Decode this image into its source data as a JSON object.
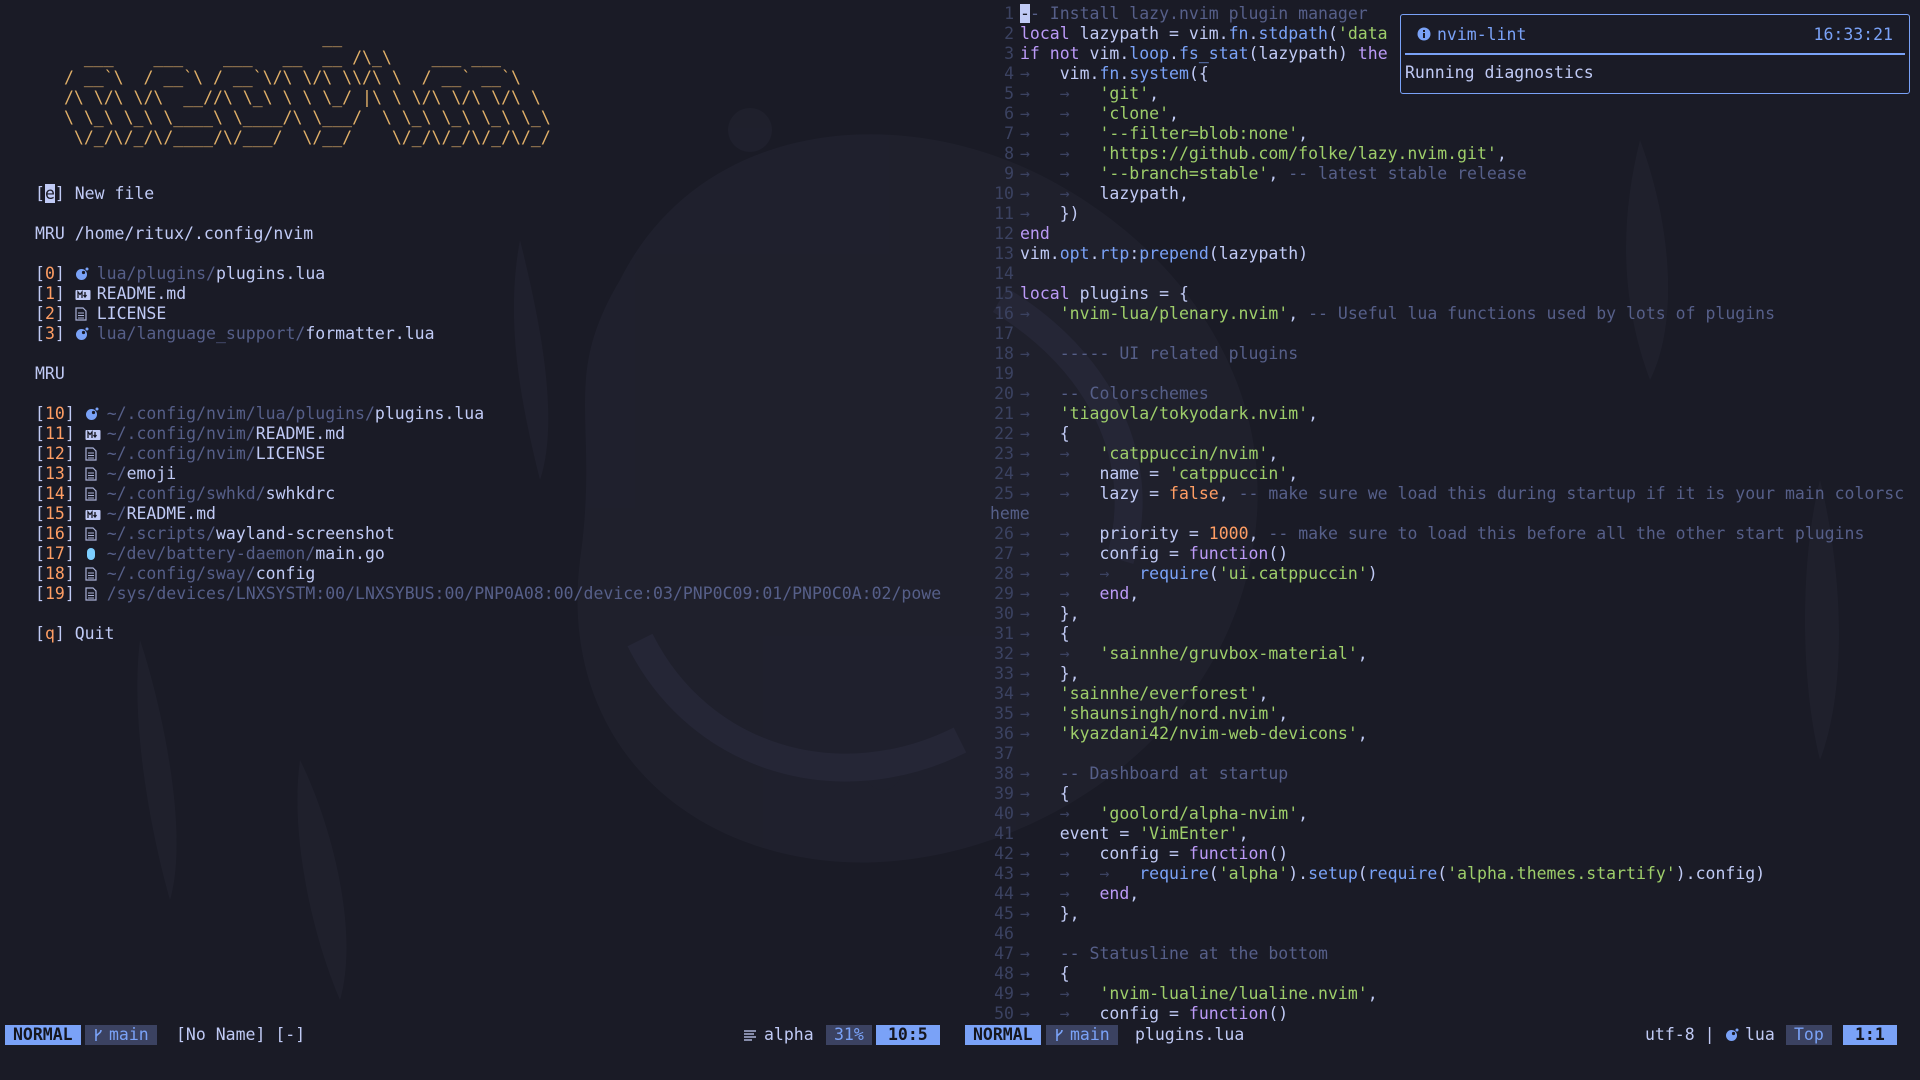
{
  "colors": {
    "background": "#1a1b26",
    "accent": "#7aa2f7",
    "banner": "#e0af68",
    "string": "#9ece6a",
    "keyword": "#bb9af7",
    "comment": "#565f89",
    "number": "#ff9e64"
  },
  "left": {
    "banner": "                          __\n  ___    ___    ___   __  __ /\\_\\    ___ ___\n/ __`\\  / __`\\ / __`\\/\\ \\/\\ \\\\/\\ \\  / __` __`\\\n/\\ \\/\\ \\/\\  __//\\ \\_\\ \\ \\ \\_/ |\\ \\ \\/\\ \\/\\ \\/\\ \\\n\\ \\_\\ \\_\\ \\____\\ \\____/\\ \\___/  \\ \\_\\ \\_\\ \\_\\ \\_\\\n \\/_/\\/_/\\/____/\\/___/  \\/__/    \\/_/\\/_/\\/_/\\/_/",
    "new_file": {
      "key": "e",
      "label": "New file"
    },
    "mru_cwd_header": "MRU /home/ritux/.config/nvim",
    "mru_cwd": [
      {
        "idx": "0",
        "icon": "lua-icon",
        "dir": "lua/plugins/",
        "file": "plugins.lua"
      },
      {
        "idx": "1",
        "icon": "markdown-icon",
        "dir": "",
        "file": "README.md"
      },
      {
        "idx": "2",
        "icon": "file-icon",
        "dir": "",
        "file": "LICENSE"
      },
      {
        "idx": "3",
        "icon": "lua-icon",
        "dir": "lua/language_support/",
        "file": "formatter.lua"
      }
    ],
    "mru_header": "MRU",
    "mru": [
      {
        "idx": "10",
        "icon": "lua-icon",
        "dir": "~/.config/nvim/lua/plugins/",
        "file": "plugins.lua"
      },
      {
        "idx": "11",
        "icon": "markdown-icon",
        "dir": "~/.config/nvim/",
        "file": "README.md"
      },
      {
        "idx": "12",
        "icon": "file-icon",
        "dir": "~/.config/nvim/",
        "file": "LICENSE"
      },
      {
        "idx": "13",
        "icon": "file-icon",
        "dir": "~/",
        "file": "emoji"
      },
      {
        "idx": "14",
        "icon": "file-icon",
        "dir": "~/.config/swhkd/",
        "file": "swhkdrc"
      },
      {
        "idx": "15",
        "icon": "markdown-icon",
        "dir": "~/",
        "file": "README.md"
      },
      {
        "idx": "16",
        "icon": "file-icon",
        "dir": "~/.scripts/",
        "file": "wayland-screenshot"
      },
      {
        "idx": "17",
        "icon": "go-icon",
        "dir": "~/dev/battery-daemon/",
        "file": "main.go"
      },
      {
        "idx": "18",
        "icon": "file-icon",
        "dir": "~/.config/sway/",
        "file": "config"
      },
      {
        "idx": "19",
        "icon": "file-icon",
        "dir": "/sys/devices/LNXSYSTM:00/LNXSYBUS:00/PNP0A08:00/device:03/PNP0C09:01/PNP0C0A:02/powe",
        "file": ""
      }
    ],
    "quit": {
      "key": "q",
      "label": "Quit"
    }
  },
  "code_lines": [
    {
      "n": "1",
      "i": 0,
      "t": [
        [
          "cur",
          "-"
        ],
        [
          "c",
          "- Install lazy.nvim plugin manager"
        ]
      ]
    },
    {
      "n": "2",
      "i": 0,
      "t": [
        [
          "k",
          "local "
        ],
        [
          "v",
          "lazypath = vim."
        ],
        [
          "f",
          "fn"
        ],
        [
          "v",
          "."
        ],
        [
          "f",
          "stdpath"
        ],
        [
          "p",
          "("
        ],
        [
          "s",
          "'data"
        ]
      ]
    },
    {
      "n": "3",
      "i": 0,
      "t": [
        [
          "k",
          "if not "
        ],
        [
          "v",
          "vim."
        ],
        [
          "f",
          "loop"
        ],
        [
          "v",
          "."
        ],
        [
          "f",
          "fs_stat"
        ],
        [
          "p",
          "("
        ],
        [
          "v",
          "lazypath"
        ],
        [
          "p",
          ") "
        ],
        [
          "k",
          "the"
        ]
      ]
    },
    {
      "n": "4",
      "i": 1,
      "t": [
        [
          "v",
          "vim."
        ],
        [
          "f",
          "fn"
        ],
        [
          "v",
          "."
        ],
        [
          "f",
          "system"
        ],
        [
          "p",
          "({"
        ]
      ]
    },
    {
      "n": "5",
      "i": 2,
      "t": [
        [
          "s",
          "'git'"
        ],
        [
          "p",
          ","
        ]
      ]
    },
    {
      "n": "6",
      "i": 2,
      "t": [
        [
          "s",
          "'clone'"
        ],
        [
          "p",
          ","
        ]
      ]
    },
    {
      "n": "7",
      "i": 2,
      "t": [
        [
          "s",
          "'--filter=blob:none'"
        ],
        [
          "p",
          ","
        ]
      ]
    },
    {
      "n": "8",
      "i": 2,
      "t": [
        [
          "s",
          "'https://github.com/folke/lazy.nvim.git'"
        ],
        [
          "p",
          ","
        ]
      ]
    },
    {
      "n": "9",
      "i": 2,
      "t": [
        [
          "s",
          "'--branch=stable'"
        ],
        [
          "p",
          ", "
        ],
        [
          "c",
          "-- latest stable release"
        ]
      ]
    },
    {
      "n": "10",
      "i": 2,
      "t": [
        [
          "v",
          "lazypath"
        ],
        [
          "p",
          ","
        ]
      ]
    },
    {
      "n": "11",
      "i": 1,
      "t": [
        [
          "p",
          "})"
        ]
      ]
    },
    {
      "n": "12",
      "i": 0,
      "t": [
        [
          "k",
          "end"
        ]
      ]
    },
    {
      "n": "13",
      "i": 0,
      "t": [
        [
          "v",
          "vim."
        ],
        [
          "f",
          "opt"
        ],
        [
          "v",
          "."
        ],
        [
          "f",
          "rtp"
        ],
        [
          "p",
          ":"
        ],
        [
          "f",
          "prepend"
        ],
        [
          "p",
          "("
        ],
        [
          "v",
          "lazypath"
        ],
        [
          "p",
          ")"
        ]
      ]
    },
    {
      "n": "14",
      "i": 0,
      "t": []
    },
    {
      "n": "15",
      "i": 0,
      "t": [
        [
          "k",
          "local "
        ],
        [
          "v",
          "plugins = "
        ],
        [
          "p",
          "{"
        ]
      ]
    },
    {
      "n": "16",
      "i": 1,
      "t": [
        [
          "s",
          "'nvim-lua/plenary.nvim'"
        ],
        [
          "p",
          ", "
        ],
        [
          "c",
          "-- Useful lua functions used by lots of plugins"
        ]
      ]
    },
    {
      "n": "17",
      "i": 0,
      "t": []
    },
    {
      "n": "18",
      "i": 1,
      "t": [
        [
          "c",
          "----- UI related plugins"
        ]
      ]
    },
    {
      "n": "19",
      "i": 0,
      "t": []
    },
    {
      "n": "20",
      "i": 1,
      "t": [
        [
          "c",
          "-- Colorschemes"
        ]
      ]
    },
    {
      "n": "21",
      "i": 1,
      "t": [
        [
          "s",
          "'tiagovla/tokyodark.nvim'"
        ],
        [
          "p",
          ","
        ]
      ]
    },
    {
      "n": "22",
      "i": 1,
      "t": [
        [
          "p",
          "{"
        ]
      ]
    },
    {
      "n": "23",
      "i": 2,
      "t": [
        [
          "s",
          "'catppuccin/nvim'"
        ],
        [
          "p",
          ","
        ]
      ]
    },
    {
      "n": "24",
      "i": 2,
      "t": [
        [
          "v",
          "name = "
        ],
        [
          "s",
          "'catppuccin'"
        ],
        [
          "p",
          ","
        ]
      ]
    },
    {
      "n": "25",
      "i": 2,
      "t": [
        [
          "v",
          "lazy = "
        ],
        [
          "n",
          "false"
        ],
        [
          "p",
          ", "
        ],
        [
          "c",
          "-- make sure we load this during startup if it is your main colorsc"
        ]
      ]
    },
    {
      "n": "",
      "i": -1,
      "t": [
        [
          "c",
          "heme"
        ]
      ]
    },
    {
      "n": "26",
      "i": 2,
      "t": [
        [
          "v",
          "priority = "
        ],
        [
          "n",
          "1000"
        ],
        [
          "p",
          ", "
        ],
        [
          "c",
          "-- make sure to load this before all the other start plugins"
        ]
      ]
    },
    {
      "n": "27",
      "i": 2,
      "t": [
        [
          "v",
          "config = "
        ],
        [
          "k",
          "function"
        ],
        [
          "p",
          "()"
        ]
      ]
    },
    {
      "n": "28",
      "i": 3,
      "t": [
        [
          "f",
          "require"
        ],
        [
          "p",
          "("
        ],
        [
          "s",
          "'ui.catppuccin'"
        ],
        [
          "p",
          ")"
        ]
      ]
    },
    {
      "n": "29",
      "i": 2,
      "t": [
        [
          "k",
          "end"
        ],
        [
          "p",
          ","
        ]
      ]
    },
    {
      "n": "30",
      "i": 1,
      "t": [
        [
          "p",
          "},"
        ]
      ]
    },
    {
      "n": "31",
      "i": 1,
      "t": [
        [
          "p",
          "{"
        ]
      ]
    },
    {
      "n": "32",
      "i": 2,
      "t": [
        [
          "s",
          "'sainnhe/gruvbox-material'"
        ],
        [
          "p",
          ","
        ]
      ]
    },
    {
      "n": "33",
      "i": 1,
      "t": [
        [
          "p",
          "},"
        ]
      ]
    },
    {
      "n": "34",
      "i": 1,
      "t": [
        [
          "s",
          "'sainnhe/everforest'"
        ],
        [
          "p",
          ","
        ]
      ]
    },
    {
      "n": "35",
      "i": 1,
      "t": [
        [
          "s",
          "'shaunsingh/nord.nvim'"
        ],
        [
          "p",
          ","
        ]
      ]
    },
    {
      "n": "36",
      "i": 1,
      "t": [
        [
          "s",
          "'kyazdani42/nvim-web-devicons'"
        ],
        [
          "p",
          ","
        ]
      ]
    },
    {
      "n": "37",
      "i": 0,
      "t": []
    },
    {
      "n": "38",
      "i": 1,
      "t": [
        [
          "c",
          "-- Dashboard at startup"
        ]
      ]
    },
    {
      "n": "39",
      "i": 1,
      "t": [
        [
          "p",
          "{"
        ]
      ]
    },
    {
      "n": "40",
      "i": 2,
      "t": [
        [
          "s",
          "'goolord/alpha-nvim'"
        ],
        [
          "p",
          ","
        ]
      ]
    },
    {
      "n": "41",
      "i": -2,
      "t": [
        [
          "v",
          "event = "
        ],
        [
          "s",
          "'VimEnter'"
        ],
        [
          "p",
          ","
        ]
      ]
    },
    {
      "n": "42",
      "i": 2,
      "t": [
        [
          "v",
          "config = "
        ],
        [
          "k",
          "function"
        ],
        [
          "p",
          "()"
        ]
      ]
    },
    {
      "n": "43",
      "i": 3,
      "t": [
        [
          "f",
          "require"
        ],
        [
          "p",
          "("
        ],
        [
          "s",
          "'alpha'"
        ],
        [
          "p",
          ")."
        ],
        [
          "f",
          "setup"
        ],
        [
          "p",
          "("
        ],
        [
          "f",
          "require"
        ],
        [
          "p",
          "("
        ],
        [
          "s",
          "'alpha.themes.startify'"
        ],
        [
          "p",
          ")."
        ],
        [
          "v",
          "config"
        ],
        [
          "p",
          ")"
        ]
      ]
    },
    {
      "n": "44",
      "i": 2,
      "t": [
        [
          "k",
          "end"
        ],
        [
          "p",
          ","
        ]
      ]
    },
    {
      "n": "45",
      "i": 1,
      "t": [
        [
          "p",
          "},"
        ]
      ]
    },
    {
      "n": "46",
      "i": 0,
      "t": []
    },
    {
      "n": "47",
      "i": 1,
      "t": [
        [
          "c",
          "-- Statusline at the bottom"
        ]
      ]
    },
    {
      "n": "48",
      "i": 1,
      "t": [
        [
          "p",
          "{"
        ]
      ]
    },
    {
      "n": "49",
      "i": 2,
      "t": [
        [
          "s",
          "'nvim-lualine/lualine.nvim'"
        ],
        [
          "p",
          ","
        ]
      ]
    },
    {
      "n": "50",
      "i": 2,
      "t": [
        [
          "v",
          "config = "
        ],
        [
          "k",
          "function"
        ],
        [
          "p",
          "()"
        ]
      ]
    }
  ],
  "notification": {
    "icon": "info-icon",
    "title": "nvim-lint",
    "time": "16:33:21",
    "body": "Running diagnostics"
  },
  "statusline_left": {
    "mode": "NORMAL",
    "branch": "main",
    "file": "[No Name] [-]",
    "filetype": "alpha",
    "percent": "31%",
    "position": "10:5"
  },
  "statusline_right": {
    "mode": "NORMAL",
    "branch": "main",
    "file": "plugins.lua",
    "encoding": "utf-8 |",
    "filetype": "lua",
    "percent": "Top",
    "position": "1:1"
  }
}
